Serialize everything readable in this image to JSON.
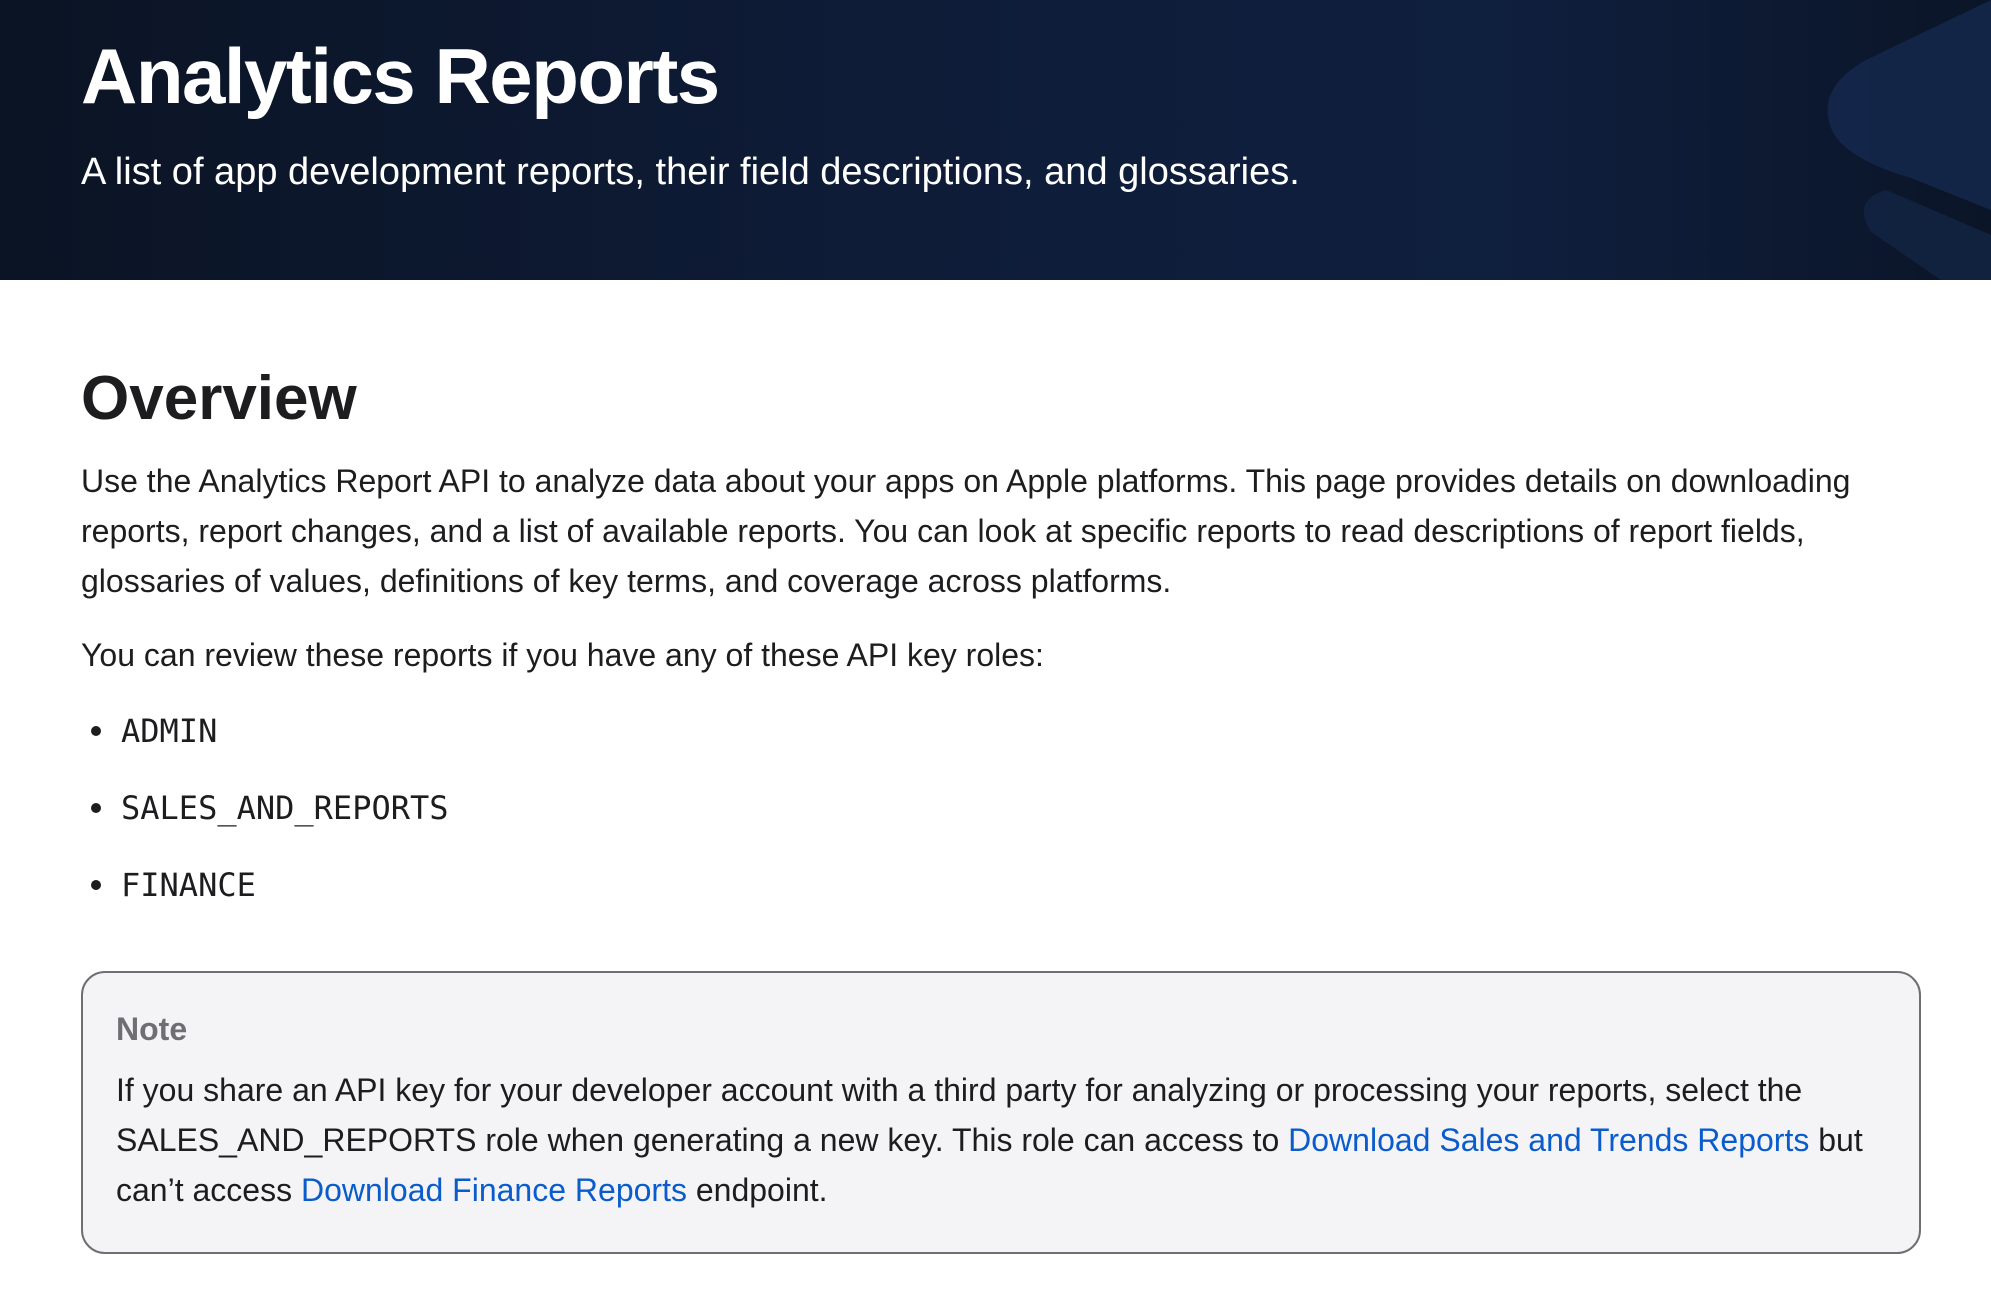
{
  "hero": {
    "title": "Analytics Reports",
    "subtitle": "A list of app development reports, their field descriptions, and glossaries."
  },
  "overview": {
    "heading": "Overview",
    "paragraph": "Use the Analytics Report API to analyze data about your apps on Apple platforms. This page provides details on downloading reports, report changes, and a list of available reports. You can look at specific reports to read descriptions of report fields, glossaries of values, definitions of key terms, and coverage across platforms.",
    "roles_intro": "You can review these reports if you have any of these API key roles:",
    "roles": [
      "ADMIN",
      "SALES_AND_REPORTS",
      "FINANCE"
    ]
  },
  "note": {
    "label": "Note",
    "text_before": "If you share an API key for your developer account with a third party for analyzing or processing your reports, select the SALES_AND_REPORTS role when generating a new key. This role can access to ",
    "link1": "Download Sales and Trends Reports",
    "text_middle": " but can’t access ",
    "link2": "Download Finance Reports",
    "text_after": " endpoint."
  },
  "colors": {
    "hero_background": "#0e1c38",
    "link": "#0a5ccc",
    "note_background": "#f4f4f6",
    "note_border": "#6e6e73"
  },
  "icons": {
    "bullet": "bullet-dot-icon",
    "hero_decoration": "hero-chevron-decoration"
  }
}
